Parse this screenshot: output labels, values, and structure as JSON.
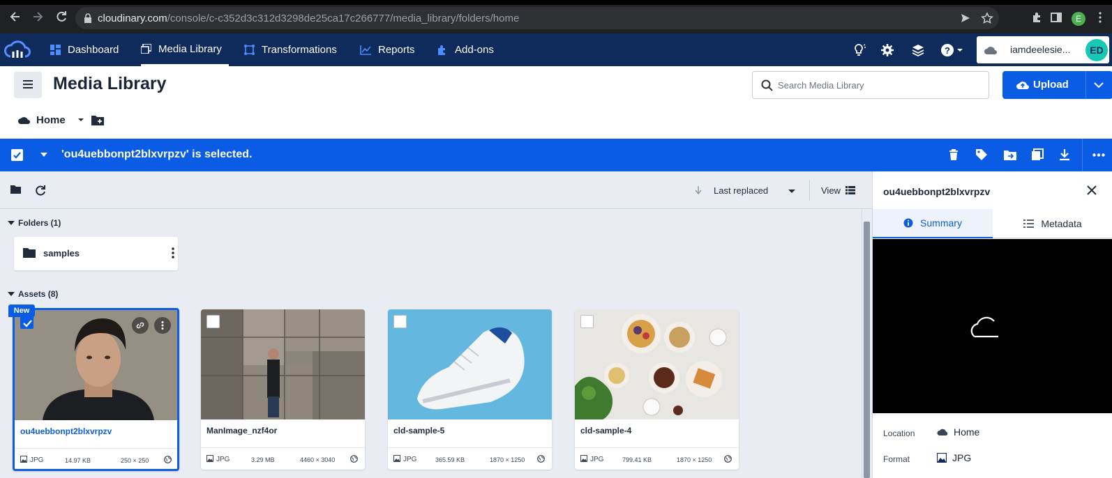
{
  "browser": {
    "url_host": "cloudinary.com",
    "url_path": "/console/c-c352d3c312d3298de25ca17c266777/media_library/folders/home",
    "profile_initial": "E"
  },
  "nav": {
    "items": [
      {
        "label": "Dashboard",
        "icon": "dashboard-icon"
      },
      {
        "label": "Media Library",
        "icon": "media-library-icon"
      },
      {
        "label": "Transformations",
        "icon": "transformations-icon"
      },
      {
        "label": "Reports",
        "icon": "reports-icon"
      },
      {
        "label": "Add-ons",
        "icon": "puzzle-icon"
      }
    ],
    "active": "Media Library",
    "account_name": "iamdeelesie...",
    "account_initials": "ED"
  },
  "header": {
    "title": "Media Library",
    "search_placeholder": "Search Media Library",
    "upload_label": "Upload",
    "breadcrumb_home": "Home"
  },
  "selection": {
    "message": "'ou4uebbonpt2blxvrpzv' is selected."
  },
  "toolbar": {
    "sort_label": "Last replaced",
    "view_label": "View"
  },
  "folders": {
    "title": "Folders (1)",
    "items": [
      {
        "name": "samples"
      }
    ]
  },
  "assets": {
    "title": "Assets (8)",
    "new_badge": "New",
    "items": [
      {
        "name": "ou4uebbonpt2blxvrpzv",
        "format": "JPG",
        "size": "14.97 KB",
        "dims": "250 × 250",
        "selected": true
      },
      {
        "name": "ManImage_nzf4or",
        "format": "JPG",
        "size": "3.29 MB",
        "dims": "4460 × 3040",
        "selected": false
      },
      {
        "name": "cld-sample-5",
        "format": "JPG",
        "size": "365.59 KB",
        "dims": "1870 × 1250",
        "selected": false
      },
      {
        "name": "cld-sample-4",
        "format": "JPG",
        "size": "799.41 KB",
        "dims": "1870 × 1250",
        "selected": false
      }
    ]
  },
  "side_panel": {
    "title": "ou4uebbonpt2blxvrpzv",
    "tabs": [
      {
        "label": "Summary"
      },
      {
        "label": "Metadata"
      }
    ],
    "location_label": "Location",
    "location_value": "Home",
    "format_label": "Format",
    "format_value": "JPG"
  },
  "colors": {
    "nav_bg": "#0e2b5c",
    "accent": "#0b5ce5",
    "teal": "#17c9b5"
  }
}
